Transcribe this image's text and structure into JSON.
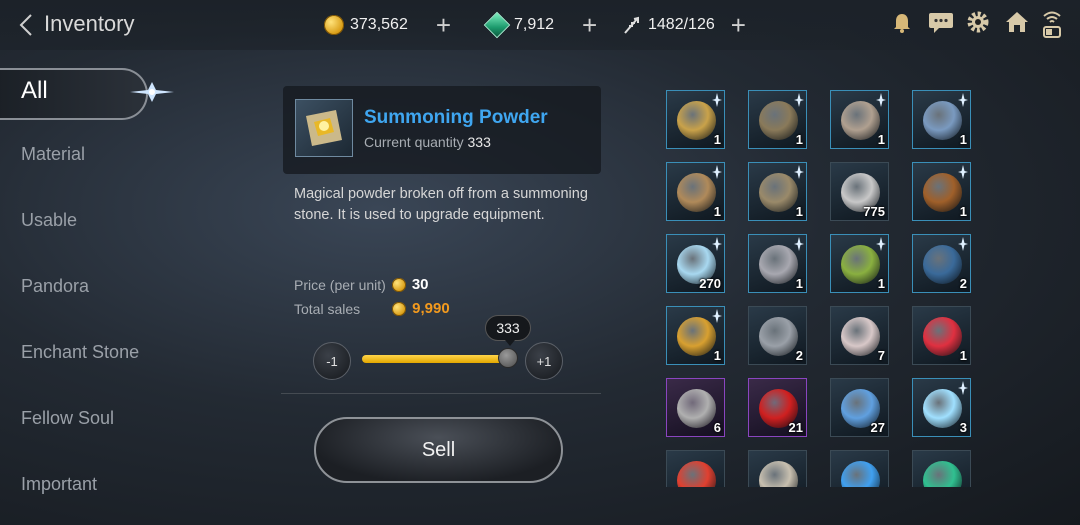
{
  "header": {
    "title": "Inventory",
    "resources": [
      {
        "icon": "gold-coin-icon",
        "value": "373,562"
      },
      {
        "icon": "green-gem-icon",
        "value": "7,912"
      },
      {
        "icon": "feather-quill-icon",
        "value": "1482/126"
      }
    ],
    "plus": "+",
    "icons": [
      "bell-icon",
      "chat-icon",
      "gear-icon",
      "home-icon",
      "wifi-battery-icon"
    ]
  },
  "sidebar": {
    "tabs": [
      {
        "label": "All",
        "active": true
      },
      {
        "label": "Material"
      },
      {
        "label": "Usable"
      },
      {
        "label": "Pandora"
      },
      {
        "label": "Enchant Stone"
      },
      {
        "label": "Fellow Soul"
      },
      {
        "label": "Important"
      }
    ]
  },
  "detail": {
    "name": "Summoning Powder",
    "quantity_label": "Current quantity",
    "quantity": "333",
    "description": "Magical powder broken off from a summoning stone. It is used to upgrade equipment.",
    "price_label": "Price (per unit)",
    "price": "30",
    "total_label": "Total sales",
    "total": "9,990",
    "minus_label": "-1",
    "plus_label": "+1",
    "slider_value": "333",
    "slider_fraction": 1.0,
    "sell_label": "Sell"
  },
  "items": [
    {
      "name": "ring-icon",
      "count": "1",
      "rarity": "rare",
      "color": "#c9a24a"
    },
    {
      "name": "armor-icon",
      "count": "1",
      "rarity": "rare",
      "color": "#8a7a5a"
    },
    {
      "name": "helmet-icon",
      "count": "1",
      "rarity": "rare",
      "color": "#b0a090"
    },
    {
      "name": "hammer-icon",
      "count": "1",
      "rarity": "rare",
      "color": "#7a9ac0"
    },
    {
      "name": "bracer-icon",
      "count": "1",
      "rarity": "rare",
      "color": "#b08a5a"
    },
    {
      "name": "boots-icon",
      "count": "1",
      "rarity": "rare",
      "color": "#9a8a6a"
    },
    {
      "name": "chain-icon",
      "count": "775",
      "rarity": "plain",
      "color": "#c8c8c8"
    },
    {
      "name": "spear-icon",
      "count": "1",
      "rarity": "rare",
      "color": "#a0602a"
    },
    {
      "name": "crystal-icon",
      "count": "270",
      "rarity": "rare",
      "color": "#a8d8f0"
    },
    {
      "name": "ring-icon",
      "count": "1",
      "rarity": "rare",
      "color": "#a8a8b0"
    },
    {
      "name": "ring-icon",
      "count": "1",
      "rarity": "rare",
      "color": "#8ab040"
    },
    {
      "name": "staff-icon",
      "count": "2",
      "rarity": "rare",
      "color": "#3a6a9a"
    },
    {
      "name": "amulet-icon",
      "count": "1",
      "rarity": "rare",
      "color": "#d8a030"
    },
    {
      "name": "axe-icon",
      "count": "2",
      "rarity": "plain",
      "color": "#9aa0a8"
    },
    {
      "name": "skull-icon",
      "count": "7",
      "rarity": "plain",
      "color": "#d8c8c8"
    },
    {
      "name": "potion-icon",
      "count": "1",
      "rarity": "plain",
      "color": "#e03040"
    },
    {
      "name": "orb-icon",
      "count": "6",
      "rarity": "epic",
      "color": "#b0b0b0"
    },
    {
      "name": "cloth-icon",
      "count": "21",
      "rarity": "epic",
      "color": "#d02020"
    },
    {
      "name": "shard-icon",
      "count": "27",
      "rarity": "plain",
      "color": "#60a0e0"
    },
    {
      "name": "light-burst-icon",
      "count": "3",
      "rarity": "rare",
      "color": "#a0e0ff"
    },
    {
      "name": "fire-orb-icon",
      "count": "",
      "rarity": "plain",
      "color": "#e04030"
    },
    {
      "name": "skull-icon",
      "count": "",
      "rarity": "plain",
      "color": "#c8c0b0"
    },
    {
      "name": "feather-icon",
      "count": "",
      "rarity": "plain",
      "color": "#40a0f0"
    },
    {
      "name": "green-orb-icon",
      "count": "",
      "rarity": "plain",
      "color": "#30c090"
    }
  ]
}
